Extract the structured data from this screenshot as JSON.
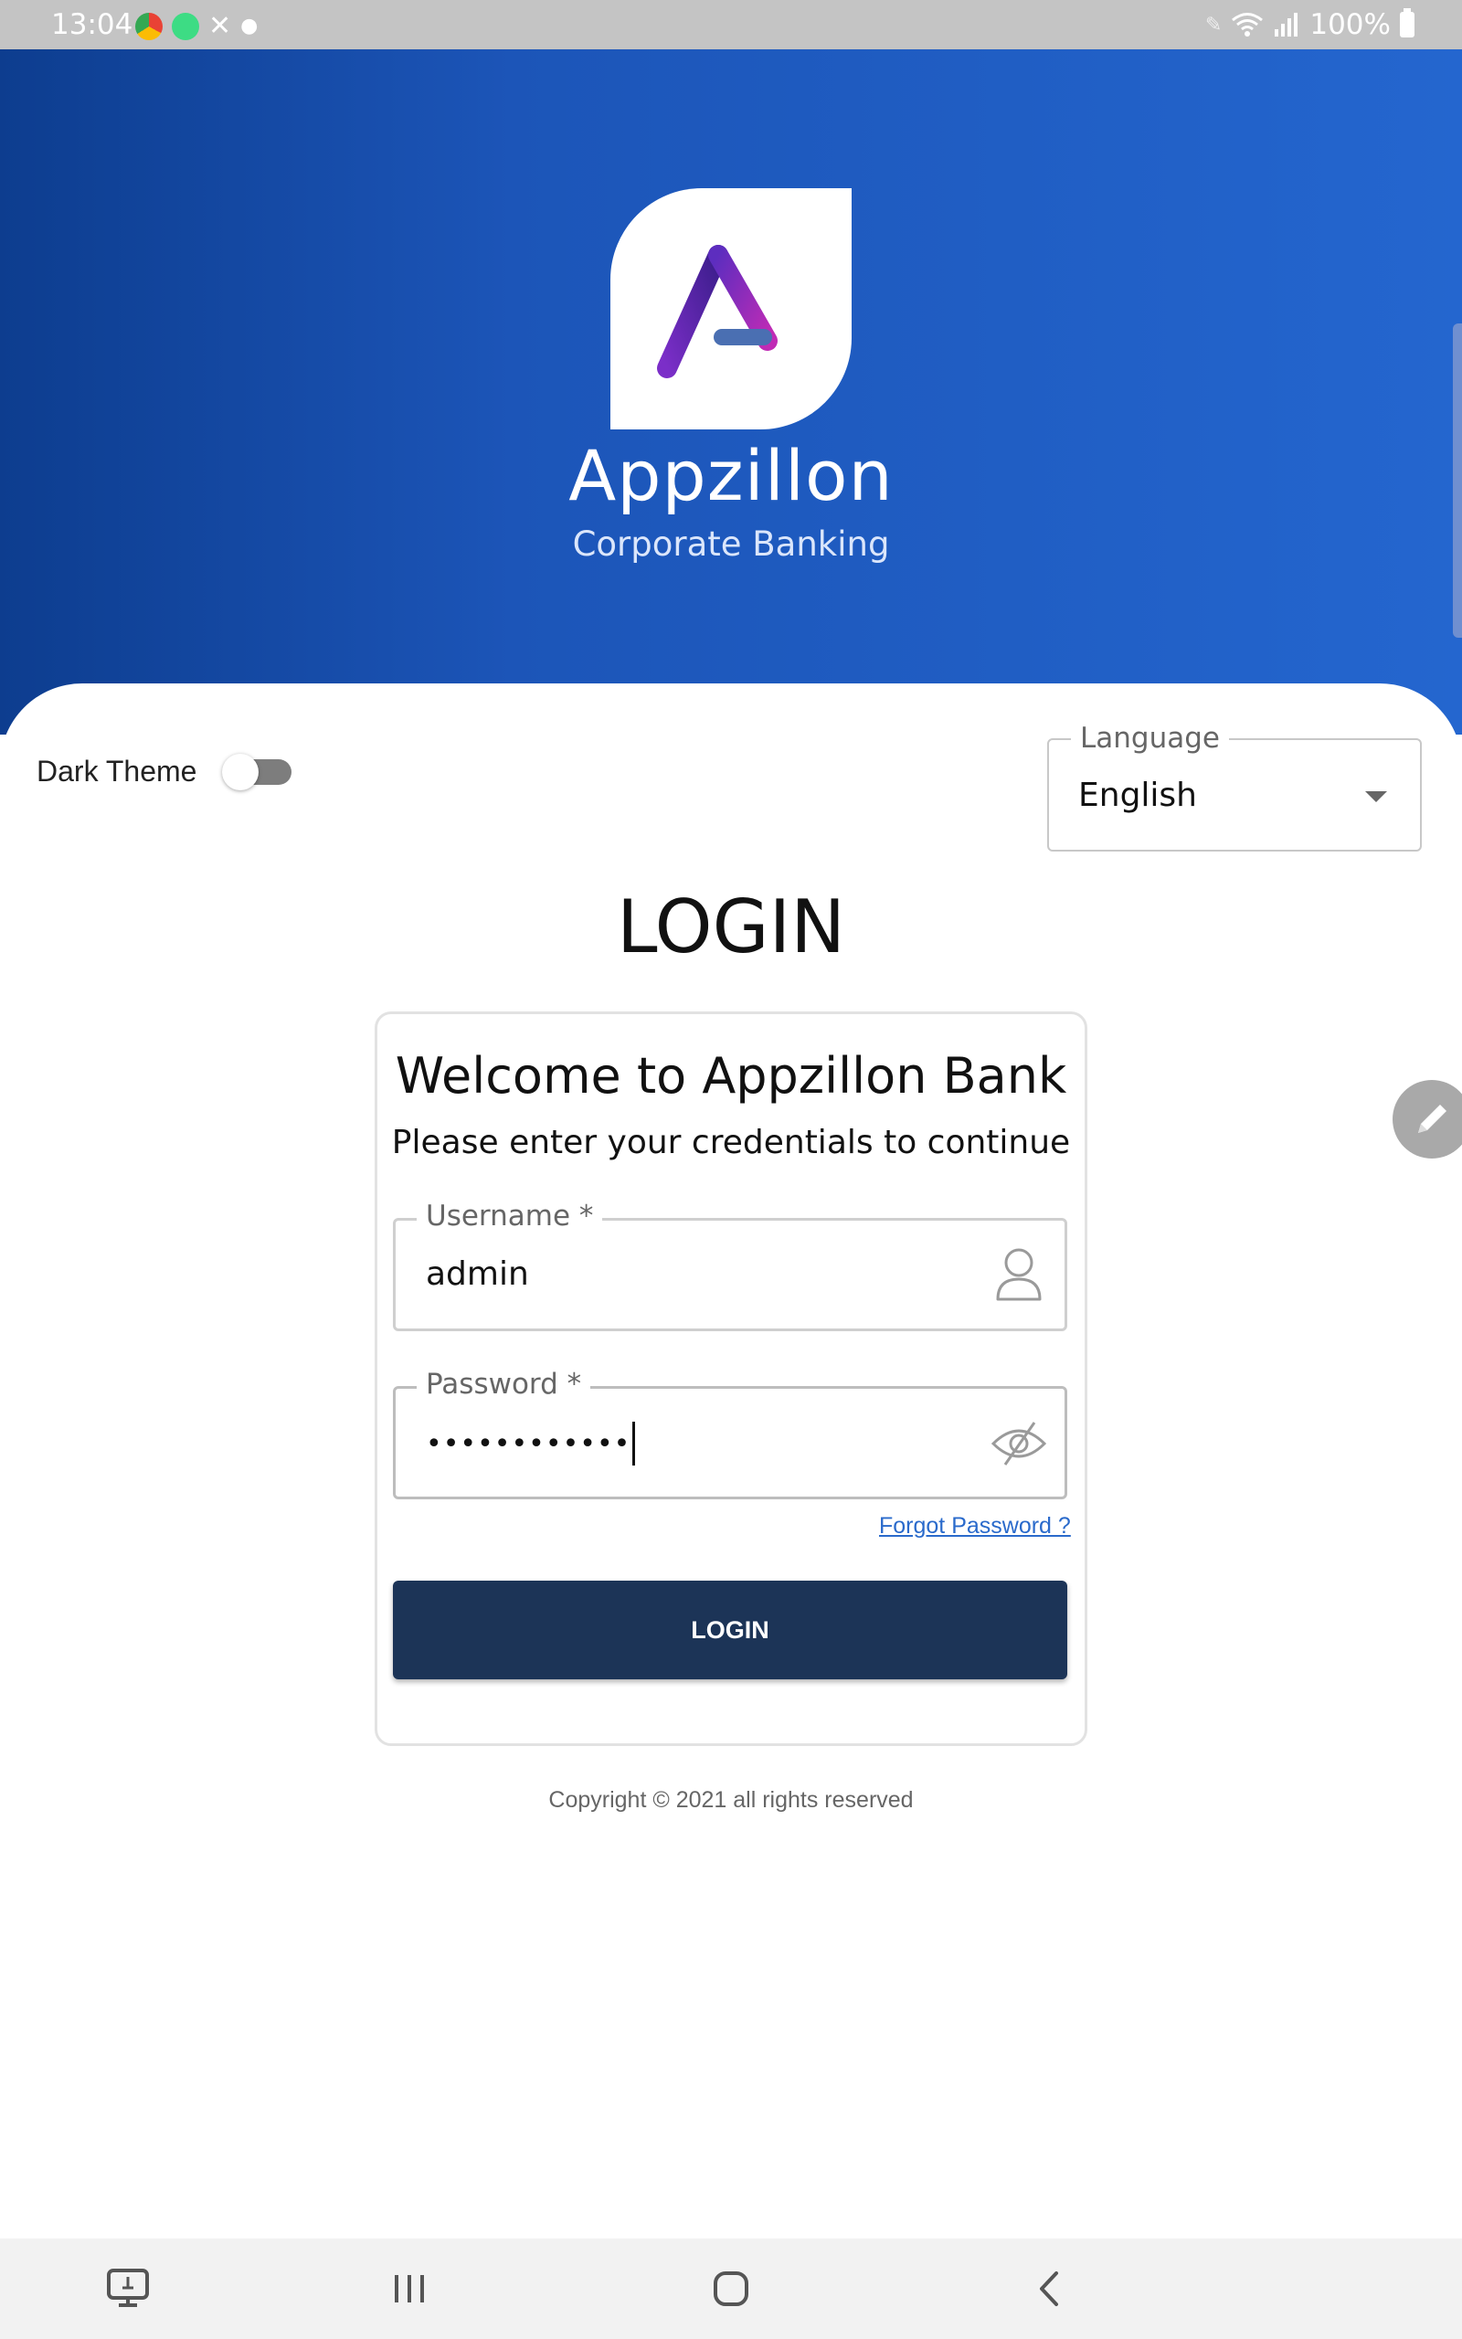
{
  "status_bar": {
    "time": "13:04",
    "battery": "100%",
    "icons": [
      "chrome-icon",
      "android-icon",
      "tools-icon",
      "dot-icon",
      "pen-icon",
      "wifi-icon",
      "signal-icon",
      "battery-icon"
    ]
  },
  "brand": {
    "name": "Appzillon",
    "subtitle": "Corporate Banking",
    "gradient_start": "#0d3d8f",
    "gradient_end": "#2466cf"
  },
  "theme": {
    "dark_theme_label": "Dark Theme",
    "dark_theme_on": false
  },
  "language": {
    "label": "Language",
    "value": "English"
  },
  "login": {
    "title": "LOGIN",
    "welcome": "Welcome to Appzillon Bank",
    "instructions": "Please enter your credentials to continue",
    "username_label": "Username *",
    "username_value": "admin",
    "password_label": "Password *",
    "password_value": "••••••••••••",
    "forgot_password": "Forgot Password ?",
    "button_label": "LOGIN",
    "button_color": "#1c3457"
  },
  "footer": {
    "copyright": "Copyright © 2021 all rights reserved"
  },
  "nav_bar": {
    "buttons": [
      "screen-share-icon",
      "recent-apps-icon",
      "home-icon",
      "back-icon"
    ]
  }
}
